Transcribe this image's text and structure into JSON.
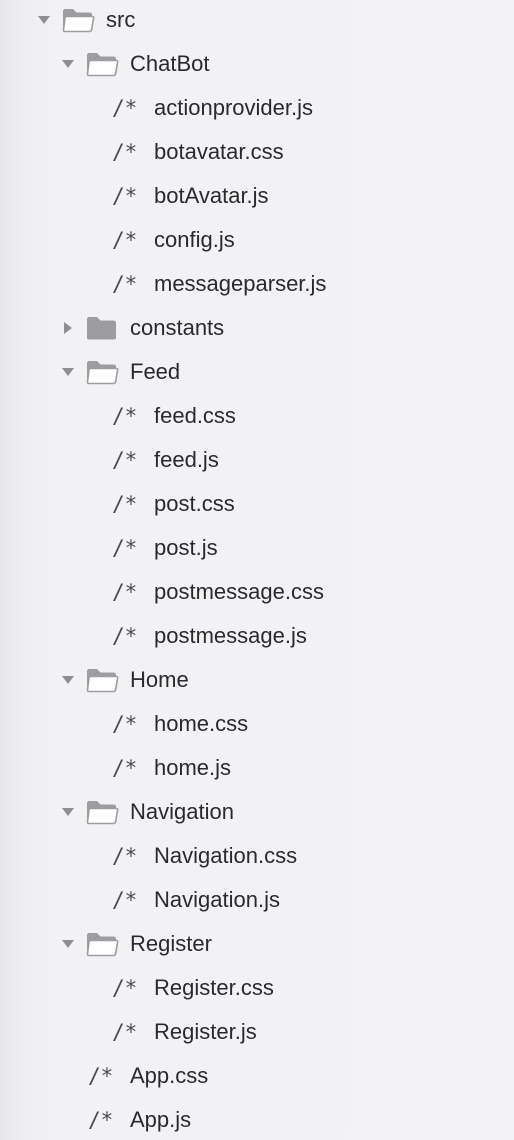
{
  "tree": [
    {
      "label": "src",
      "kind": "folder",
      "depth": 0,
      "expanded": true,
      "icon": "folder-open-icon"
    },
    {
      "label": "ChatBot",
      "kind": "folder",
      "depth": 1,
      "expanded": true,
      "icon": "folder-open-icon"
    },
    {
      "label": "actionprovider.js",
      "kind": "file",
      "depth": 2,
      "icon": "js-file-icon",
      "glyph": "/*"
    },
    {
      "label": "botavatar.css",
      "kind": "file",
      "depth": 2,
      "icon": "css-file-icon",
      "glyph": "/*"
    },
    {
      "label": "botAvatar.js",
      "kind": "file",
      "depth": 2,
      "icon": "js-file-icon",
      "glyph": "/*"
    },
    {
      "label": "config.js",
      "kind": "file",
      "depth": 2,
      "icon": "js-file-icon",
      "glyph": "/*"
    },
    {
      "label": "messageparser.js",
      "kind": "file",
      "depth": 2,
      "icon": "js-file-icon",
      "glyph": "/*"
    },
    {
      "label": "constants",
      "kind": "folder",
      "depth": 1,
      "expanded": false,
      "icon": "folder-closed-icon"
    },
    {
      "label": "Feed",
      "kind": "folder",
      "depth": 1,
      "expanded": true,
      "icon": "folder-open-icon"
    },
    {
      "label": "feed.css",
      "kind": "file",
      "depth": 2,
      "icon": "css-file-icon",
      "glyph": "/*"
    },
    {
      "label": "feed.js",
      "kind": "file",
      "depth": 2,
      "icon": "js-file-icon",
      "glyph": "/*"
    },
    {
      "label": "post.css",
      "kind": "file",
      "depth": 2,
      "icon": "css-file-icon",
      "glyph": "/*"
    },
    {
      "label": "post.js",
      "kind": "file",
      "depth": 2,
      "icon": "js-file-icon",
      "glyph": "/*"
    },
    {
      "label": "postmessage.css",
      "kind": "file",
      "depth": 2,
      "icon": "css-file-icon",
      "glyph": "/*"
    },
    {
      "label": "postmessage.js",
      "kind": "file",
      "depth": 2,
      "icon": "js-file-icon",
      "glyph": "/*"
    },
    {
      "label": "Home",
      "kind": "folder",
      "depth": 1,
      "expanded": true,
      "icon": "folder-open-icon"
    },
    {
      "label": "home.css",
      "kind": "file",
      "depth": 2,
      "icon": "css-file-icon",
      "glyph": "/*"
    },
    {
      "label": "home.js",
      "kind": "file",
      "depth": 2,
      "icon": "js-file-icon",
      "glyph": "/*"
    },
    {
      "label": "Navigation",
      "kind": "folder",
      "depth": 1,
      "expanded": true,
      "icon": "folder-open-icon"
    },
    {
      "label": "Navigation.css",
      "kind": "file",
      "depth": 2,
      "icon": "css-file-icon",
      "glyph": "/*"
    },
    {
      "label": "Navigation.js",
      "kind": "file",
      "depth": 2,
      "icon": "js-file-icon",
      "glyph": "/*"
    },
    {
      "label": "Register",
      "kind": "folder",
      "depth": 1,
      "expanded": true,
      "icon": "folder-open-icon"
    },
    {
      "label": "Register.css",
      "kind": "file",
      "depth": 2,
      "icon": "css-file-icon",
      "glyph": "/*"
    },
    {
      "label": "Register.js",
      "kind": "file",
      "depth": 2,
      "icon": "js-file-icon",
      "glyph": "/*"
    },
    {
      "label": "App.css",
      "kind": "file",
      "depth": 1,
      "icon": "css-file-icon",
      "glyph": "/*"
    },
    {
      "label": "App.js",
      "kind": "file",
      "depth": 1,
      "icon": "js-file-icon",
      "glyph": "/*"
    }
  ],
  "colors": {
    "folder": "#9d9da1",
    "disclosure": "#8e8e93",
    "text": "#2a2a2c",
    "file_glyph": "#4b4b4f",
    "sidebar_background": "#f3f3f5"
  }
}
